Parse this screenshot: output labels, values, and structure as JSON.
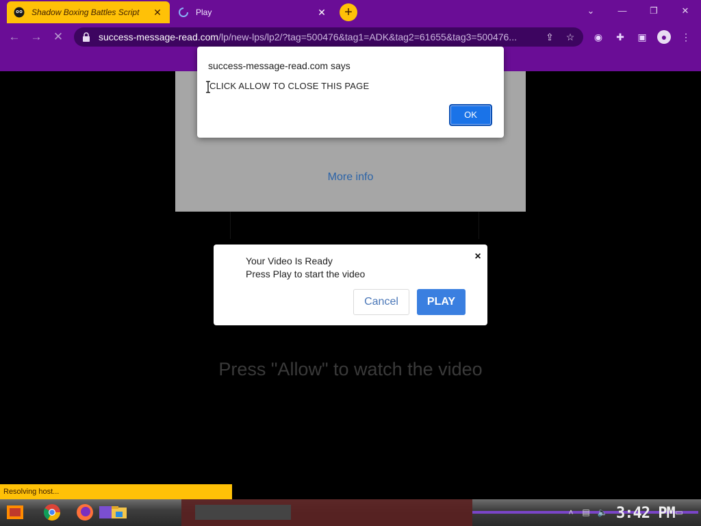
{
  "browser": {
    "tabs": [
      {
        "title": "Shadow Boxing Battles Script",
        "active": true
      },
      {
        "title": "Play",
        "active": false
      }
    ],
    "new_tab": "+",
    "url_domain": "success-message-read.com",
    "url_path": "/lp/new-lps/lp2/?tag=500476&tag1=ADK&tag2=61655&tag3=500476..."
  },
  "page": {
    "more_info": "More info",
    "big_text": "Press \"Allow\" to watch the video"
  },
  "alert": {
    "title": "success-message-read.com says",
    "message": "CLICK ALLOW TO CLOSE THIS PAGE",
    "ok": "OK"
  },
  "modal": {
    "line1": "Your Video Is Ready",
    "line2": "Press Play to start the video",
    "close": "×",
    "cancel": "Cancel",
    "play": "PLAY"
  },
  "status": "Resolving host...",
  "taskbar": {
    "clock": "3:42 PM"
  },
  "colors": {
    "theme_purple": "#6a0d96",
    "theme_yellow": "#ffc107",
    "primary_blue": "#1a73e8"
  }
}
